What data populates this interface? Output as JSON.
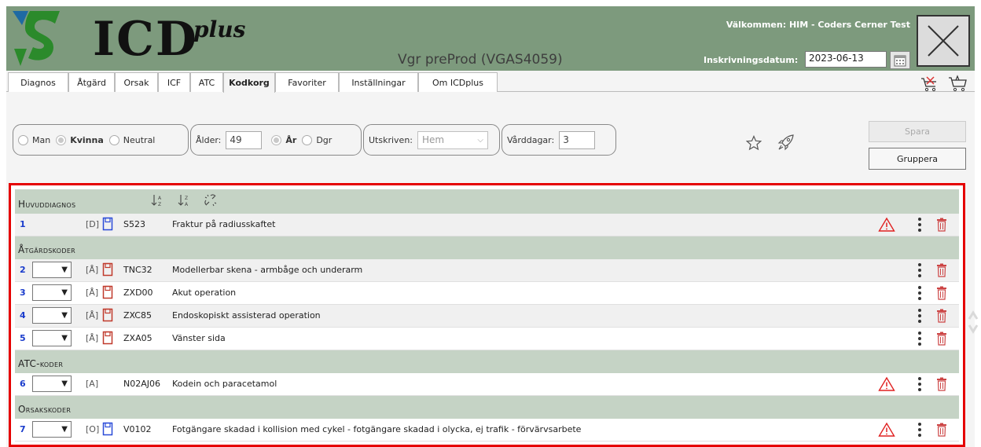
{
  "header": {
    "logo_text": "ICD",
    "logo_plus": "plus",
    "env_label": "Vgr preProd (VGAS4059)",
    "welcome": "Välkommen: HIM - Coders Cerner Test",
    "inskrivning_label": "Inskrivningsdatum:",
    "inskrivning_date": "2023-06-13",
    "brand_green": "#7d9a7d",
    "logo_blue": "#1e6aa3",
    "logo_green": "#2b8a2b"
  },
  "tabs": [
    {
      "label": "Diagnos",
      "active": false
    },
    {
      "label": "Åtgärd",
      "active": false
    },
    {
      "label": "Orsak",
      "active": false
    },
    {
      "label": "ICF",
      "active": false
    },
    {
      "label": "ATC",
      "active": false
    },
    {
      "label": "Kodkorg",
      "active": true
    },
    {
      "label": "Favoriter",
      "active": false
    },
    {
      "label": "Inställningar",
      "active": false
    },
    {
      "label": "Om ICDplus",
      "active": false
    }
  ],
  "patient": {
    "gender_options": [
      "Man",
      "Kvinna",
      "Neutral"
    ],
    "gender_selected": "Kvinna",
    "age_label": "Ålder:",
    "age_value": "49",
    "age_unit_options": [
      "År",
      "Dgr"
    ],
    "age_unit_selected": "År",
    "discharged_label": "Utskriven:",
    "discharged_value": "Hem",
    "care_days_label": "Vårddagar:",
    "care_days_value": "3",
    "save_button": "Spara",
    "group_button": "Gruppera"
  },
  "basket": {
    "accent_red": "#e50000",
    "sections": [
      {
        "title": "Huvuddiagnos",
        "rows": [
          {
            "num": "1",
            "select": false,
            "type": "[D]",
            "book": "blue",
            "code": "S523",
            "desc": "Fraktur på radiusskaftet",
            "warning": true
          }
        ]
      },
      {
        "title": "Åtgärdskoder",
        "rows": [
          {
            "num": "2",
            "select": true,
            "type": "[Å]",
            "book": "red",
            "code": "TNC32",
            "desc": "Modellerbar skena - armbåge och underarm",
            "warning": false
          },
          {
            "num": "3",
            "select": true,
            "type": "[Å]",
            "book": "red",
            "code": "ZXD00",
            "desc": "Akut operation",
            "warning": false
          },
          {
            "num": "4",
            "select": true,
            "type": "[Å]",
            "book": "red",
            "code": "ZXC85",
            "desc": "Endoskopiskt assisterad operation",
            "warning": false
          },
          {
            "num": "5",
            "select": true,
            "type": "[Å]",
            "book": "red",
            "code": "ZXA05",
            "desc": "Vänster sida",
            "warning": false
          }
        ]
      },
      {
        "title": "ATC-koder",
        "rows": [
          {
            "num": "6",
            "select": true,
            "type": "[A]",
            "book": "none",
            "code": "N02AJ06",
            "desc": "Kodein och paracetamol",
            "warning": true
          }
        ]
      },
      {
        "title": "Orsakskoder",
        "rows": [
          {
            "num": "7",
            "select": true,
            "type": "[O]",
            "book": "blue",
            "code": "V0102",
            "desc": "Fotgängare skadad i kollision med cykel - fotgängare skadad i olycka, ej trafik - förvärvsarbete",
            "warning": true
          }
        ]
      }
    ]
  }
}
